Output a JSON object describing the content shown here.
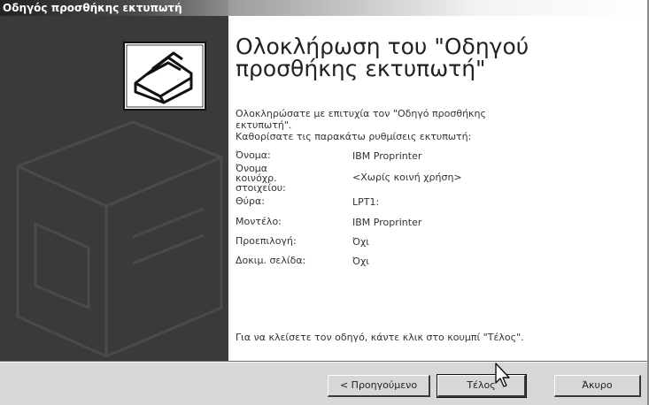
{
  "window": {
    "title": "Οδηγός προσθήκης εκτυπωτή"
  },
  "content": {
    "heading_line1": "Ολοκλήρωση του \"Οδηγού",
    "heading_line2": "προσθήκης εκτυπωτή\"",
    "success_line1": "Ολοκληρώσατε με επιτυχία τον \"Οδηγό προσθήκης",
    "success_line2": "εκτυπωτή\".",
    "settings_intro": "Καθορίσατε τις παρακάτω ρυθμίσεις εκτυπωτή:",
    "settings": [
      {
        "label": "Όνομα:",
        "value": "IBM Proprinter"
      },
      {
        "label": "Όνομα κοινόχρ. στοιχείου:",
        "value": "<Χωρίς κοινή χρήση>"
      },
      {
        "label": "Θύρα:",
        "value": "LPT1:"
      },
      {
        "label": "Μοντέλο:",
        "value": "IBM Proprinter"
      },
      {
        "label": "Προεπιλογή:",
        "value": "Όχι"
      },
      {
        "label": "Δοκιμ. σελίδα:",
        "value": "Όχι"
      }
    ],
    "finish_hint": "Για να κλείσετε τον οδηγό, κάντε κλικ στο κουμπί \"Τέλος\"."
  },
  "buttons": {
    "back": "< Προηγούμενο",
    "finish": "Τέλος",
    "cancel": "Άκυρο"
  },
  "icons": {
    "wizard": "printer-icon",
    "pointer": "mouse-cursor-icon"
  }
}
